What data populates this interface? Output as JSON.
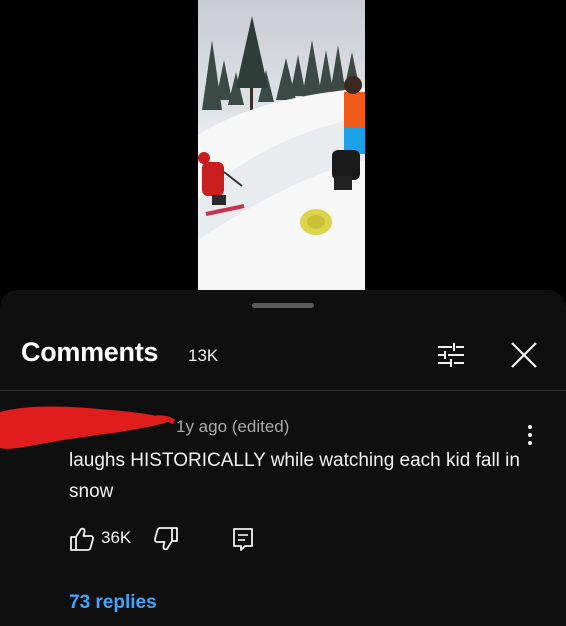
{
  "comments_header": {
    "title": "Comments",
    "count": "13K"
  },
  "comment": {
    "meta": "1y ago (edited)",
    "text": "laughs HISTORICALLY while watching each kid fall in snow",
    "like_count": "36K",
    "replies_label": "73 replies"
  },
  "icons": {
    "filter": "filter-sliders-icon",
    "close": "close-icon",
    "more": "more-vertical-icon",
    "like": "thumbs-up-icon",
    "dislike": "thumbs-down-icon",
    "reply": "reply-icon"
  },
  "colors": {
    "sheet_background": "#0f0f0f",
    "link": "#3ea6ff",
    "meta_text": "#aaaaaa",
    "redaction": "#e01c1c"
  }
}
